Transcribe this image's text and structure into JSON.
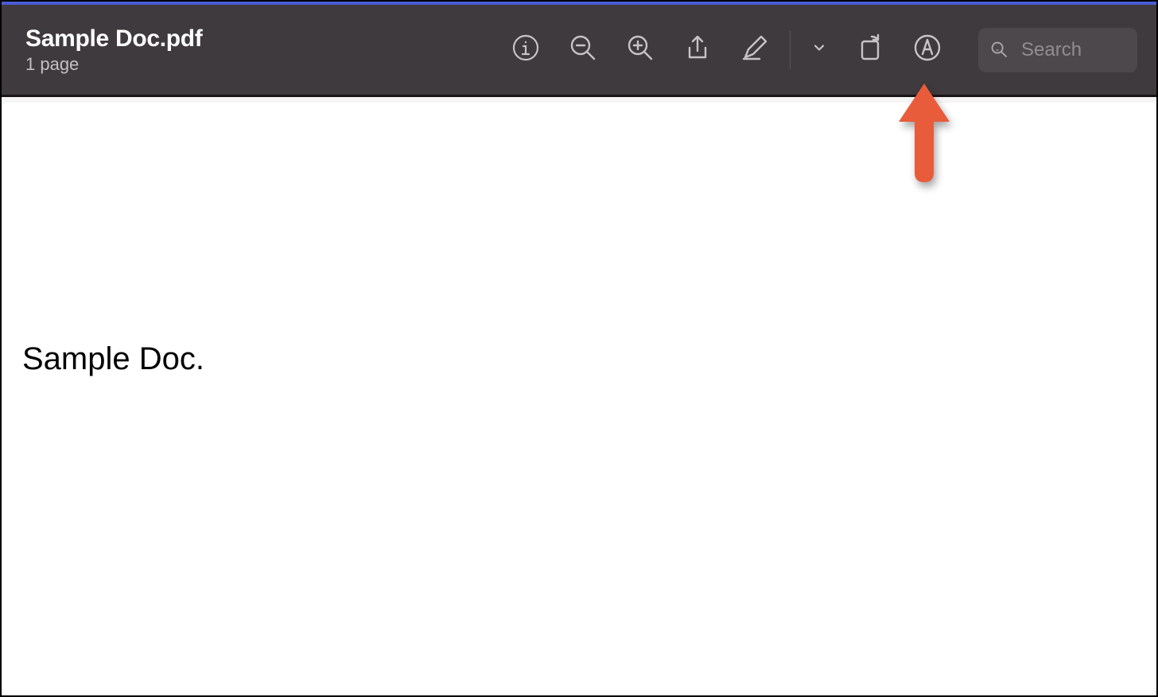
{
  "header": {
    "title": "Sample Doc.pdf",
    "subtitle": "1 page"
  },
  "toolbar": {
    "info_icon": "info",
    "zoom_out_icon": "zoom-out",
    "zoom_in_icon": "zoom-in",
    "share_icon": "share",
    "highlight_icon": "highlight",
    "dropdown_icon": "chevron-down",
    "rotate_icon": "rotate",
    "markup_icon": "markup"
  },
  "search": {
    "placeholder": "Search",
    "value": ""
  },
  "document": {
    "body_text": "Sample Doc."
  },
  "annotation": {
    "arrow_color": "#e85b3b",
    "points_to": "markup-button"
  }
}
